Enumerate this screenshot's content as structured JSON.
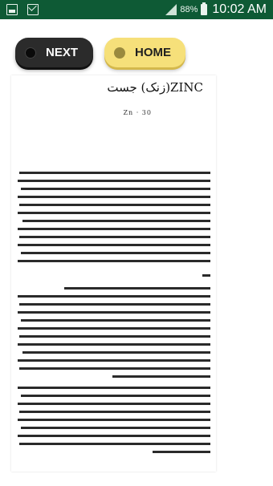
{
  "status_bar": {
    "battery": "88%",
    "time": "10:02 AM",
    "icons": [
      "photo-icon",
      "mail-icon",
      "signal-icon",
      "battery-icon"
    ]
  },
  "buttons": {
    "next_label": "NEXT",
    "home_label": "HOME"
  },
  "document": {
    "title": "ZINC(زنک) جست",
    "subtitle": "Zn · 30"
  },
  "colors": {
    "status_bar": "#0e5a35",
    "next_button": "#2b2b2b",
    "home_button": "#f6e07a"
  }
}
